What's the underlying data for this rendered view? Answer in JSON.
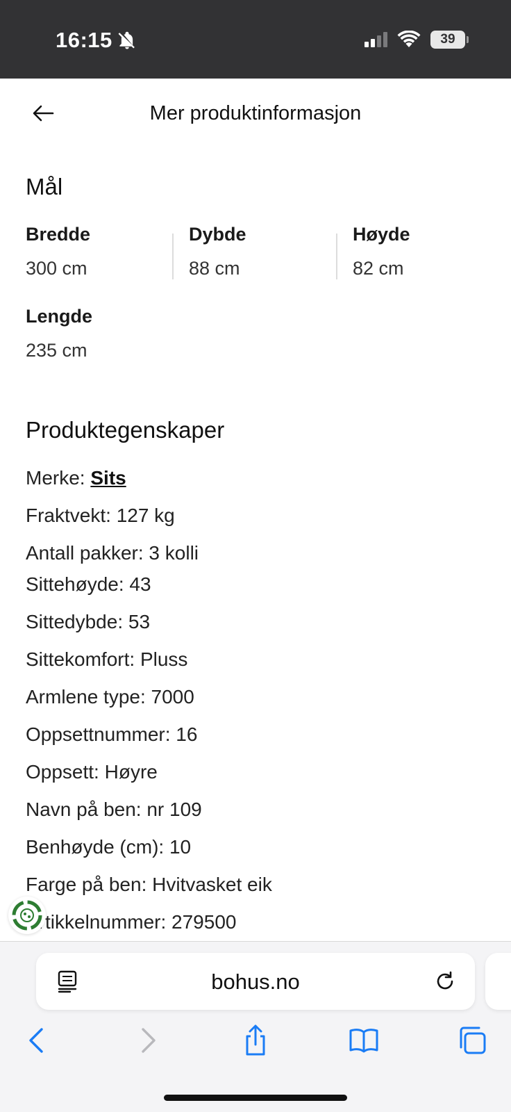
{
  "status_bar": {
    "time": "16:15",
    "battery": "39",
    "icons": [
      "bell-off-icon",
      "cellular-signal-icon",
      "wifi-icon",
      "battery-icon"
    ]
  },
  "header": {
    "title": "Mer produktinformasjon",
    "back_icon": "back-arrow-icon"
  },
  "dimensions": {
    "title": "Mål",
    "items": [
      {
        "label": "Bredde",
        "value": "300 cm"
      },
      {
        "label": "Dybde",
        "value": "88 cm"
      },
      {
        "label": "Høyde",
        "value": "82 cm"
      },
      {
        "label": "Lengde",
        "value": "235 cm"
      }
    ]
  },
  "properties": {
    "title": "Produktegenskaper",
    "brand_label": "Merke:",
    "brand_link": "Sits",
    "items": [
      "Fraktvekt: 127 kg",
      "Antall pakker: 3 kolli",
      "Sittehøyde: 43",
      "Sittedybde: 53",
      "Sittekomfort: Pluss",
      "Armlene type: 7000",
      "Oppsettnummer: 16",
      "Oppsett: Høyre",
      "Navn på ben: nr 109",
      "Benhøyde (cm): 10",
      "Farge på ben: Hvitvasket eik",
      "Artikkelnummer: 279500"
    ]
  },
  "browser": {
    "url": "bohus.no",
    "icons": [
      "reader-icon",
      "reload-icon",
      "back-icon",
      "forward-icon",
      "share-icon",
      "bookmarks-icon",
      "tabs-icon"
    ]
  },
  "colors": {
    "status_bar_bg": "#323234",
    "browser_bar_bg": "#f4f4f6",
    "toolbar_blue": "#1a7cf5",
    "eco_green": "#2e7d32"
  }
}
